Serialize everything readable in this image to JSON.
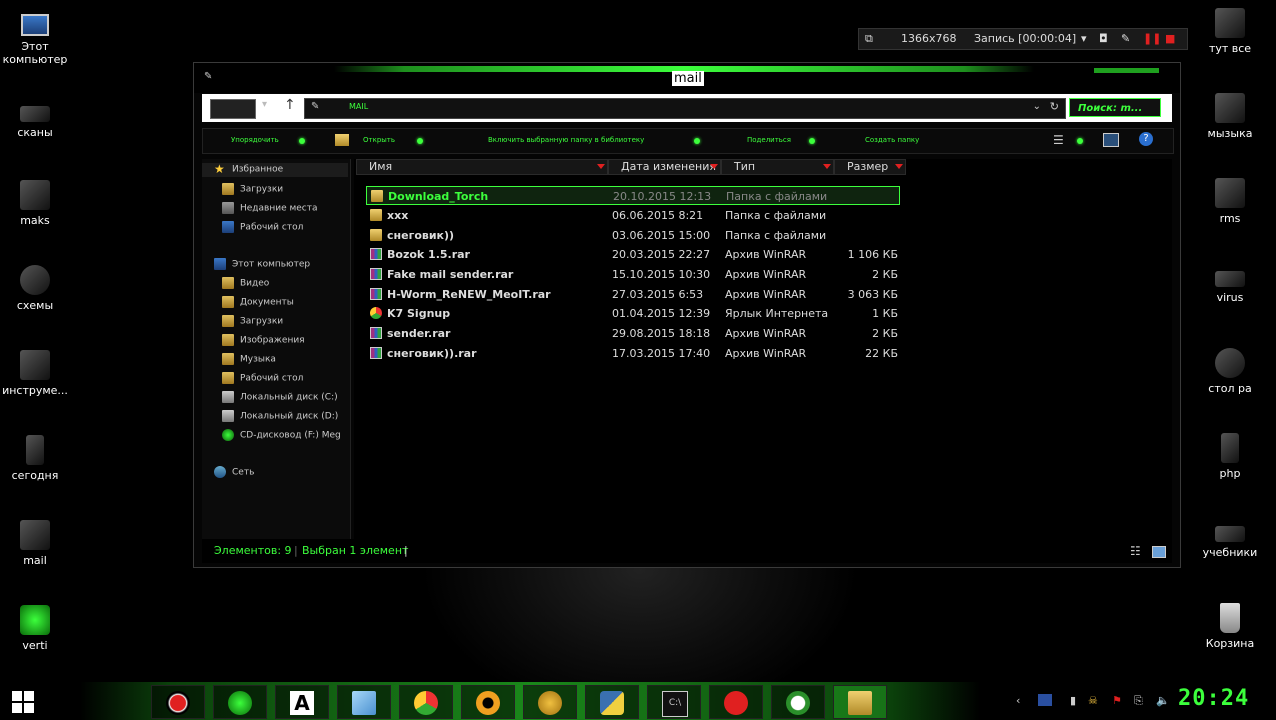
{
  "desktop": {
    "left_icons": [
      {
        "label": "Этот\nкомпьютер",
        "icon": "computer-icon"
      },
      {
        "label": "сканы",
        "icon": "scanner-icon"
      },
      {
        "label": "maks",
        "icon": "folder-icon"
      },
      {
        "label": "схемы",
        "icon": "folder-icon"
      },
      {
        "label": "инструме...",
        "icon": "tools-icon"
      },
      {
        "label": "сегодня",
        "icon": "folder-icon"
      },
      {
        "label": "mail",
        "icon": "folder-icon"
      },
      {
        "label": "verti",
        "icon": "app-icon"
      }
    ],
    "right_icons": [
      {
        "label": "тут все",
        "icon": "folder-icon"
      },
      {
        "label": "мызыка",
        "icon": "folder-icon"
      },
      {
        "label": "rms",
        "icon": "folder-icon"
      },
      {
        "label": "virus",
        "icon": "folder-icon"
      },
      {
        "label": "стол ра",
        "icon": "folder-icon"
      },
      {
        "label": "php",
        "icon": "folder-icon"
      },
      {
        "label": "учебники",
        "icon": "folder-icon"
      },
      {
        "label": "Корзина",
        "icon": "recycle-bin-icon"
      }
    ]
  },
  "recorder": {
    "resolution": "1366x768",
    "status": "Запись [00:00:04]"
  },
  "window": {
    "title": "mail",
    "address": "MAIL",
    "search_placeholder": "Поиск: m...",
    "toolbar": {
      "organize": "Упорядочить",
      "open": "Открыть",
      "include_library": "Включить выбранную папку в библиотеку",
      "share": "Поделиться",
      "new_folder": "Создать папку"
    },
    "nav": {
      "favorites": "Избранное",
      "favorites_items": [
        "Загрузки",
        "Недавние места",
        "Рабочий стол"
      ],
      "computer": "Этот компьютер",
      "computer_items": [
        "Видео",
        "Документы",
        "Загрузки",
        "Изображения",
        "Музыка",
        "Рабочий стол",
        "Локальный диск (C:)",
        "Локальный диск (D:)",
        "CD-дисковод (F:) Meg"
      ],
      "network": "Сеть"
    },
    "columns": {
      "name": "Имя",
      "date": "Дата изменения",
      "type": "Тип",
      "size": "Размер"
    },
    "files": [
      {
        "name": "Download_Torch",
        "date": "20.10.2015 12:13",
        "type": "Папка с файлами",
        "size": "",
        "kind": "folder",
        "selected": true
      },
      {
        "name": "xxx",
        "date": "06.06.2015 8:21",
        "type": "Папка с файлами",
        "size": "",
        "kind": "folder",
        "selected": false
      },
      {
        "name": "снеговик))",
        "date": "03.06.2015 15:00",
        "type": "Папка с файлами",
        "size": "",
        "kind": "folder",
        "selected": false
      },
      {
        "name": "Bozok 1.5.rar",
        "date": "20.03.2015 22:27",
        "type": "Архив WinRAR",
        "size": "1 106 КБ",
        "kind": "rar",
        "selected": false
      },
      {
        "name": "Fake mail sender.rar",
        "date": "15.10.2015 10:30",
        "type": "Архив WinRAR",
        "size": "2 КБ",
        "kind": "rar",
        "selected": false
      },
      {
        "name": "H-Worm_ReNEW_MeoIT.rar",
        "date": "27.03.2015 6:53",
        "type": "Архив WinRAR",
        "size": "3 063 КБ",
        "kind": "rar",
        "selected": false
      },
      {
        "name": "K7 Signup",
        "date": "01.04.2015 12:39",
        "type": "Ярлык Интернета",
        "size": "1 КБ",
        "kind": "link",
        "selected": false
      },
      {
        "name": "sender.rar",
        "date": "29.08.2015 18:18",
        "type": "Архив WinRAR",
        "size": "2 КБ",
        "kind": "rar",
        "selected": false
      },
      {
        "name": "снеговик)).rar",
        "date": "17.03.2015 17:40",
        "type": "Архив WinRAR",
        "size": "22 КБ",
        "kind": "rar",
        "selected": false
      }
    ],
    "status": {
      "count": "Элементов: 9",
      "selected": "Выбран 1 элемент"
    }
  },
  "taskbar": {
    "clock": "20:24",
    "apps": [
      "record-icon",
      "network-app-icon",
      "font-app-icon",
      "notepad-icon",
      "chrome-icon",
      "aimp-icon",
      "sun-icon",
      "python-icon",
      "terminal-icon",
      "pinterest-icon",
      "mail-agent-icon",
      "explorer-icon"
    ]
  },
  "colors": {
    "accent": "#3cff3c",
    "arrow": "#e02020"
  }
}
